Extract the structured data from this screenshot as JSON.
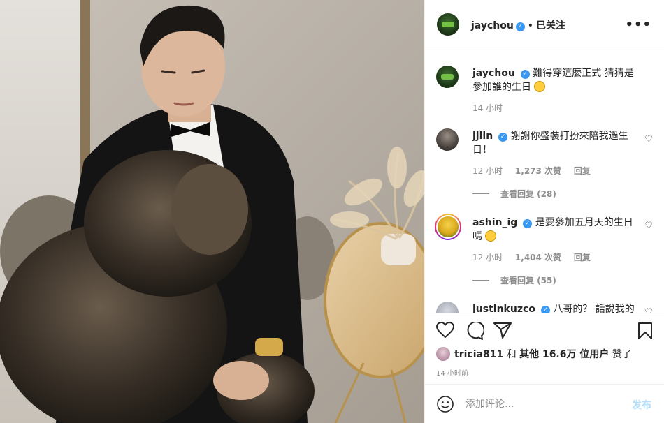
{
  "post": {
    "author": "jaychou",
    "follow_status": "已关注",
    "caption_text": "難得穿這麼正式 猜猜是參加誰的生日",
    "caption_time": "14 小时"
  },
  "comments": [
    {
      "username": "jjlin",
      "text": "謝謝你盛裝打扮來陪我過生日！",
      "time": "12 小时",
      "likes": "1,273 次赞",
      "reply": "回复",
      "view_replies": "查看回复 (28)"
    },
    {
      "username": "ashin_ig",
      "text": "是要參加五月天的生日嗎",
      "time": "12 小时",
      "likes": "1,404 次赞",
      "reply": "回复",
      "view_replies": "查看回复 (55)"
    },
    {
      "username": "justinkuzco",
      "text": "八哥的？ 話說我的"
    }
  ],
  "liked_by": {
    "user": "tricia811",
    "and": "和",
    "others": "其他 16.6万 位用户",
    "suffix": "赞了"
  },
  "posted_ago": "14 小时前",
  "comment_box": {
    "placeholder": "添加评论...",
    "post_label": "发布"
  },
  "icons": {
    "verified": "verified-badge-icon",
    "more": "more-options-icon",
    "like": "heart-icon",
    "comment": "comment-bubble-icon",
    "share": "paper-plane-icon",
    "save": "bookmark-icon",
    "emoji": "smiley-face-icon"
  },
  "colors": {
    "verified_blue": "#3897f0",
    "muted_text": "#8e8e8e",
    "post_button_disabled": "#b2dffc"
  }
}
